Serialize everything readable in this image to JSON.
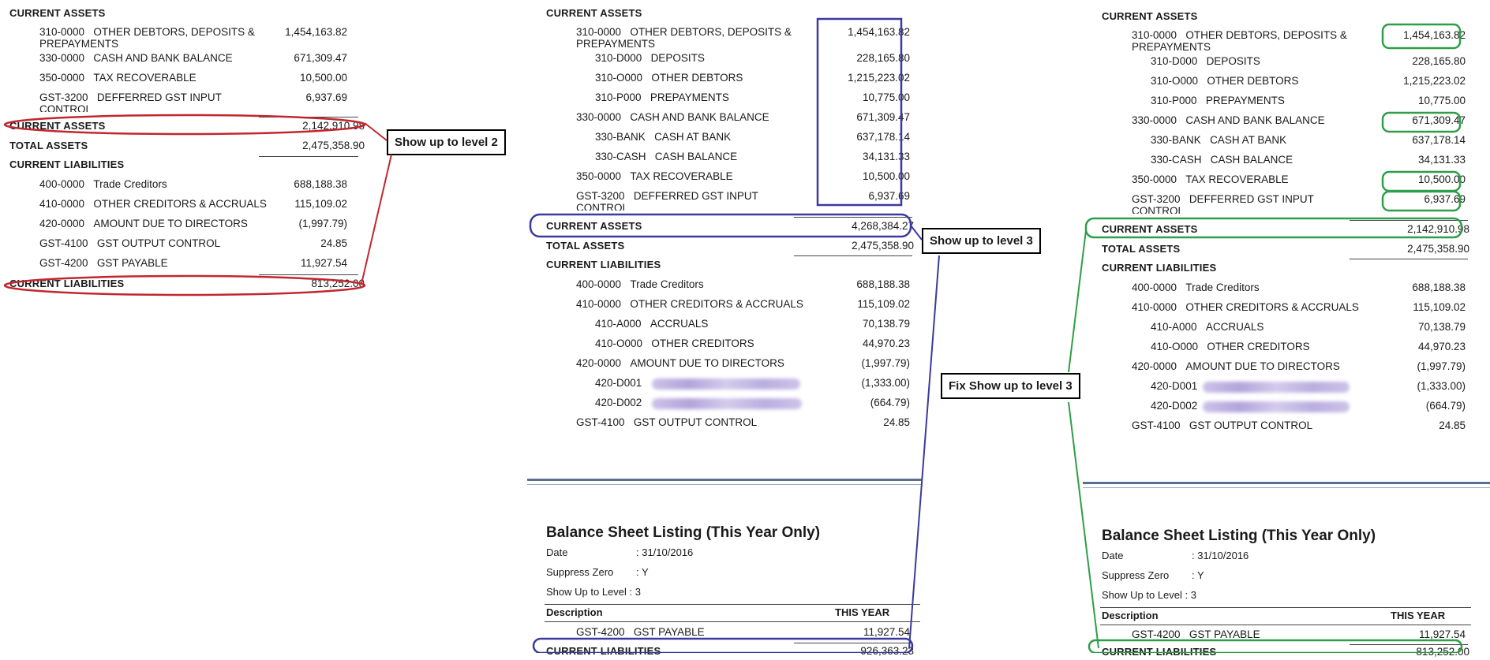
{
  "left": {
    "current_assets_header": "CURRENT ASSETS",
    "rows": [
      {
        "code": "310-0000",
        "desc": "OTHER DEBTORS, DEPOSITS & PREPAYMENTS",
        "amount": "1,454,163.82"
      },
      {
        "code": "330-0000",
        "desc": "CASH AND BANK BALANCE",
        "amount": "671,309.47"
      },
      {
        "code": "350-0000",
        "desc": "TAX RECOVERABLE",
        "amount": "10,500.00"
      },
      {
        "code": "GST-3200",
        "desc": "DEFFERRED GST INPUT CONTROL",
        "amount": "6,937.69"
      }
    ],
    "current_assets_total_label": "CURRENT ASSETS",
    "current_assets_total": "2,142,910.98",
    "total_assets_label": "TOTAL ASSETS",
    "total_assets": "2,475,358.90",
    "current_liabilities_header": "CURRENT LIABILITIES",
    "liab_rows": [
      {
        "code": "400-0000",
        "desc": "Trade Creditors",
        "amount": "688,188.38"
      },
      {
        "code": "410-0000",
        "desc": "OTHER CREDITORS & ACCRUALS",
        "amount": "115,109.02"
      },
      {
        "code": "420-0000",
        "desc": "AMOUNT DUE TO DIRECTORS",
        "amount": "(1,997.79)"
      },
      {
        "code": "GST-4100",
        "desc": "GST OUTPUT CONTROL",
        "amount": "24.85"
      },
      {
        "code": "GST-4200",
        "desc": "GST PAYABLE",
        "amount": "11,927.54"
      }
    ],
    "current_liabilities_total_label": "CURRENT LIABILITIES",
    "current_liabilities_total": "813,252.00",
    "callout": "Show up to level 2"
  },
  "middle": {
    "current_assets_header": "CURRENT ASSETS",
    "rows": [
      {
        "code": "310-0000",
        "desc": "OTHER DEBTORS, DEPOSITS & PREPAYMENTS",
        "amount": "1,454,163.82"
      },
      {
        "code": "310-D000",
        "desc": "DEPOSITS",
        "amount": "228,165.80"
      },
      {
        "code": "310-O000",
        "desc": "OTHER DEBTORS",
        "amount": "1,215,223.02"
      },
      {
        "code": "310-P000",
        "desc": "PREPAYMENTS",
        "amount": "10,775.00"
      },
      {
        "code": "330-0000",
        "desc": "CASH AND BANK BALANCE",
        "amount": "671,309.47"
      },
      {
        "code": "330-BANK",
        "desc": "CASH AT BANK",
        "amount": "637,178.14"
      },
      {
        "code": "330-CASH",
        "desc": "CASH BALANCE",
        "amount": "34,131.33"
      },
      {
        "code": "350-0000",
        "desc": "TAX RECOVERABLE",
        "amount": "10,500.00"
      },
      {
        "code": "GST-3200",
        "desc": "DEFFERRED GST INPUT CONTROL",
        "amount": "6,937.69"
      }
    ],
    "current_assets_total_label": "CURRENT ASSETS",
    "current_assets_total": "4,268,384.27",
    "total_assets_label": "TOTAL ASSETS",
    "total_assets": "2,475,358.90",
    "current_liabilities_header": "CURRENT LIABILITIES",
    "liab_rows": [
      {
        "code": "400-0000",
        "desc": "Trade Creditors",
        "amount": "688,188.38"
      },
      {
        "code": "410-0000",
        "desc": "OTHER CREDITORS & ACCRUALS",
        "amount": "115,109.02"
      },
      {
        "code": "410-A000",
        "desc": "ACCRUALS",
        "amount": "70,138.79"
      },
      {
        "code": "410-O000",
        "desc": "OTHER CREDITORS",
        "amount": "44,970.23"
      },
      {
        "code": "420-0000",
        "desc": "AMOUNT DUE TO DIRECTORS",
        "amount": "(1,997.79)"
      },
      {
        "code": "420-D001",
        "desc": "",
        "amount": "(1,333.00)"
      },
      {
        "code": "420-D002",
        "desc": "",
        "amount": "(664.79)"
      },
      {
        "code": "GST-4100",
        "desc": "GST OUTPUT CONTROL",
        "amount": "24.85"
      }
    ],
    "report_title": "Balance Sheet Listing (This Year Only)",
    "meta_date_label": "Date",
    "meta_date_value": ": 31/10/2016",
    "meta_suppress_label": "Suppress Zero",
    "meta_suppress_value": ": Y",
    "meta_level": "Show Up to Level : 3",
    "col_description": "Description",
    "col_this_year": "THIS YEAR",
    "page2_row": {
      "code": "GST-4200",
      "desc": "GST PAYABLE",
      "amount": "11,927.54"
    },
    "current_liabilities_total_label": "CURRENT LIABILITIES",
    "current_liabilities_total": "926,363.23",
    "callout": "Show up to level 3"
  },
  "right": {
    "current_assets_header": "CURRENT ASSETS",
    "rows": [
      {
        "code": "310-0000",
        "desc": "OTHER DEBTORS, DEPOSITS & PREPAYMENTS",
        "amount": "1,454,163.82"
      },
      {
        "code": "310-D000",
        "desc": "DEPOSITS",
        "amount": "228,165.80"
      },
      {
        "code": "310-O000",
        "desc": "OTHER DEBTORS",
        "amount": "1,215,223.02"
      },
      {
        "code": "310-P000",
        "desc": "PREPAYMENTS",
        "amount": "10,775.00"
      },
      {
        "code": "330-0000",
        "desc": "CASH AND BANK BALANCE",
        "amount": "671,309.47"
      },
      {
        "code": "330-BANK",
        "desc": "CASH AT BANK",
        "amount": "637,178.14"
      },
      {
        "code": "330-CASH",
        "desc": "CASH BALANCE",
        "amount": "34,131.33"
      },
      {
        "code": "350-0000",
        "desc": "TAX RECOVERABLE",
        "amount": "10,500.00"
      },
      {
        "code": "GST-3200",
        "desc": "DEFFERRED GST INPUT CONTROL",
        "amount": "6,937.69"
      }
    ],
    "current_assets_total_label": "CURRENT ASSETS",
    "current_assets_total": "2,142,910.98",
    "total_assets_label": "TOTAL ASSETS",
    "total_assets": "2,475,358.90",
    "current_liabilities_header": "CURRENT LIABILITIES",
    "liab_rows": [
      {
        "code": "400-0000",
        "desc": "Trade Creditors",
        "amount": "688,188.38"
      },
      {
        "code": "410-0000",
        "desc": "OTHER CREDITORS & ACCRUALS",
        "amount": "115,109.02"
      },
      {
        "code": "410-A000",
        "desc": "ACCRUALS",
        "amount": "70,138.79"
      },
      {
        "code": "410-O000",
        "desc": "OTHER CREDITORS",
        "amount": "44,970.23"
      },
      {
        "code": "420-0000",
        "desc": "AMOUNT DUE TO DIRECTORS",
        "amount": "(1,997.79)"
      },
      {
        "code": "420-D001",
        "desc": "",
        "amount": "(1,333.00)"
      },
      {
        "code": "420-D002",
        "desc": "",
        "amount": "(664.79)"
      },
      {
        "code": "GST-4100",
        "desc": "GST OUTPUT CONTROL",
        "amount": "24.85"
      }
    ],
    "report_title": "Balance Sheet Listing (This Year Only)",
    "meta_date_label": "Date",
    "meta_date_value": ": 31/10/2016",
    "meta_suppress_label": "Suppress Zero",
    "meta_suppress_value": ": Y",
    "meta_level": "Show Up to Level : 3",
    "col_description": "Description",
    "col_this_year": "THIS YEAR",
    "page2_row": {
      "code": "GST-4200",
      "desc": "GST PAYABLE",
      "amount": "11,927.54"
    },
    "current_liabilities_total_label": "CURRENT LIABILITIES",
    "current_liabilities_total": "813,252.00",
    "callout": "Fix Show up to level 3"
  },
  "colors": {
    "red": "#c0282e",
    "blue": "#3a3aa0",
    "green": "#2e9e48"
  }
}
